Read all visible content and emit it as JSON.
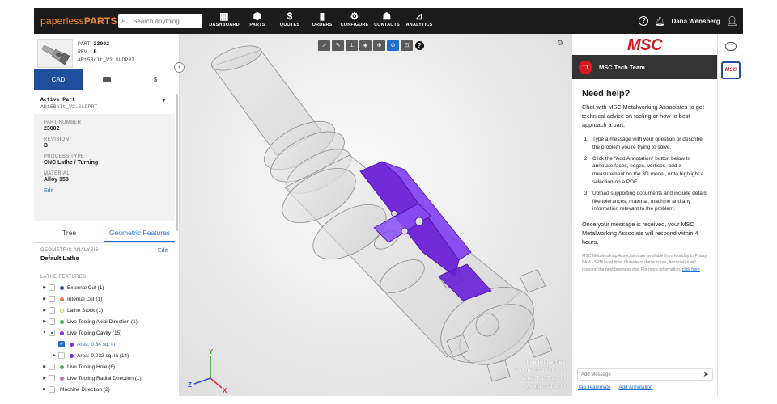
{
  "brand": {
    "logo_a": "paperless",
    "logo_b": "PARTS",
    "accent": "#f28a2a"
  },
  "search": {
    "placeholder": "Search anything"
  },
  "nav": {
    "items": [
      {
        "label": "DASHBOARD",
        "icon": "grid-icon"
      },
      {
        "label": "PARTS",
        "icon": "cube-icon"
      },
      {
        "label": "QUOTES",
        "icon": "dollar-icon"
      },
      {
        "label": "ORDERS",
        "icon": "clipboard-icon"
      },
      {
        "label": "CONFIGURE",
        "icon": "gears-icon"
      },
      {
        "label": "CONTACTS",
        "icon": "contacts-icon"
      },
      {
        "label": "ANALYTICS",
        "icon": "chart-icon"
      }
    ],
    "user_name": "Dana Wensberg"
  },
  "part_header": {
    "part_label": "PART",
    "part_value": "23002",
    "rev_label": "REV",
    "rev_value": "B",
    "filename": "AR15Bolt_V2.SLDPRT"
  },
  "panel_tabs": {
    "cad": "CAD",
    "folder": "folder-icon",
    "dollar": "$"
  },
  "active_part": {
    "label": "Active Part",
    "file": "AR15Bolt_V2.SLDPRT"
  },
  "properties": {
    "part_number_label": "PART NUMBER",
    "part_number": "23002",
    "revision_label": "REVISION",
    "revision": "B",
    "process_label": "PROCESS TYPE",
    "process": "CNC Lathe / Turning",
    "material_label": "MATERIAL",
    "material": "Alloy 158",
    "edit": "Edit"
  },
  "tree_tabs": {
    "tree": "Tree",
    "geometric": "Geometric Features"
  },
  "geometric": {
    "label": "GEOMETRIC ANALYSIS",
    "value": "Default Lathe",
    "edit": "Edit"
  },
  "lathe": {
    "title": "LATHE FEATURES",
    "features": [
      {
        "text": "External Cut (1)",
        "color": "#1f4e9c",
        "indent": 0,
        "state": "none",
        "ring": false,
        "tri": "▶"
      },
      {
        "text": "Internal Cut (1)",
        "color": "#e07b39",
        "indent": 0,
        "state": "none",
        "ring": false,
        "tri": "▶"
      },
      {
        "text": "Lathe Stock (1)",
        "color": "#e0c040",
        "indent": 0,
        "state": "none",
        "ring": true,
        "tri": "▶"
      },
      {
        "text": "Live Tooling Axial Direction (1)",
        "color": "#3bb34a",
        "indent": 0,
        "state": "none",
        "ring": false,
        "tri": "▶"
      },
      {
        "text": "Live Tooling Cavity (15)",
        "color": "#8a2be2",
        "indent": 0,
        "state": "partial",
        "ring": false,
        "tri": "▼"
      },
      {
        "text": "Area: 0.64 sq. in",
        "color": "#8a2be2",
        "indent": 1,
        "state": "checked",
        "ring": false,
        "tri": "",
        "sel": true
      },
      {
        "text": "Area: 0.032 sq. in (14)",
        "color": "#8a2be2",
        "indent": 1,
        "state": "none",
        "ring": false,
        "tri": "▶"
      },
      {
        "text": "Live Tooling Hole (6)",
        "color": "#3bb34a",
        "indent": 0,
        "state": "none",
        "ring": false,
        "tri": "▶"
      },
      {
        "text": "Live Tooling Radial Direction (1)",
        "color": "#cc66cc",
        "indent": 0,
        "state": "none",
        "ring": false,
        "tri": "▶"
      },
      {
        "text": "Machine Direction (2)",
        "color": "",
        "indent": 0,
        "state": "none",
        "ring": false,
        "tri": "▶"
      }
    ]
  },
  "viewer": {
    "tools": [
      "pointer-icon",
      "measure-icon",
      "annotate-icon",
      "cube-view-icon",
      "globe-icon",
      "hide-icon",
      "fit-icon",
      "help-icon"
    ],
    "active_tool_index": 5,
    "file_props_title": "File Properties",
    "volume": "Volume: 0.303 cu. in",
    "area": "Area: 7.177 sq. in",
    "weight": "Weight: 0.108 lb",
    "axis_x": "X",
    "axis_y": "Y",
    "axis_z": "Z"
  },
  "chat": {
    "logo": "MSC",
    "team_initials": "TT",
    "team_name": "MSC Tech Team",
    "heading": "Need help?",
    "intro": "Chat with MSC Metalworking Associates to get technical advice on tooling or how to best approach a part.",
    "steps": [
      "Type a message with your question or describe the problem you're trying to solve.",
      "Click the \"Add Annotation\" button below to annotate faces, edges, vertices, add a measurement on the 3D model, or to highlight a selection on a PDF.",
      "Upload supporting documents and include details like tolerances, material, machine and any information relevant to the problem."
    ],
    "outro": "Once your message is received, your MSC Metalworking Associate will respond within 4 hours.",
    "availability": "MSC Metalworking Associates are available from Monday to Friday, 8AM - 5PM local time. Outside of these hours, Associates will respond the next business day. For more information,",
    "click_here": "click here",
    "placeholder": "Add Message",
    "tag_teammate": "Tag Teammate",
    "add_annotation": "Add Annotation"
  },
  "rail": {
    "msc_label": "MSC"
  }
}
